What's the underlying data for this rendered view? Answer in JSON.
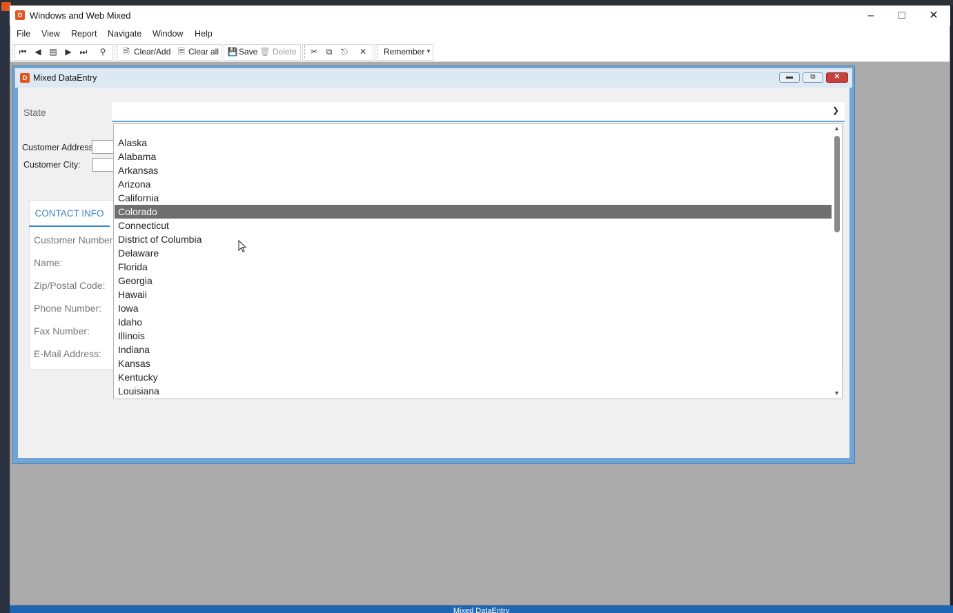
{
  "window": {
    "title": "Windows and Web Mixed"
  },
  "menu": [
    "File",
    "View",
    "Report",
    "Navigate",
    "Window",
    "Help"
  ],
  "toolbar": {
    "clear_add": "Clear/Add",
    "clear_all": "Clear all",
    "save": "Save",
    "delete": "Delete",
    "remember": "Remember"
  },
  "child": {
    "title": "Mixed DataEntry"
  },
  "form": {
    "state_label": "State",
    "customer_address_label": "Customer Address:",
    "customer_city_label": "Customer City:",
    "tab_contact": "CONTACT INFO",
    "labels": [
      "Customer Number:",
      "Name:",
      "Zip/Postal Code:",
      "Phone Number:",
      "Fax Number:",
      "E-Mail Address:"
    ]
  },
  "dropdown": {
    "options": [
      "Alaska",
      "Alabama",
      "Arkansas",
      "Arizona",
      "California",
      "Colorado",
      "Connecticut",
      "District of Columbia",
      "Delaware",
      "Florida",
      "Georgia",
      "Hawaii",
      "Iowa",
      "Idaho",
      "Illinois",
      "Indiana",
      "Kansas",
      "Kentucky",
      "Louisiana"
    ],
    "selected_index": 5
  },
  "statusbar": {
    "text": "Mixed DataEntry"
  }
}
